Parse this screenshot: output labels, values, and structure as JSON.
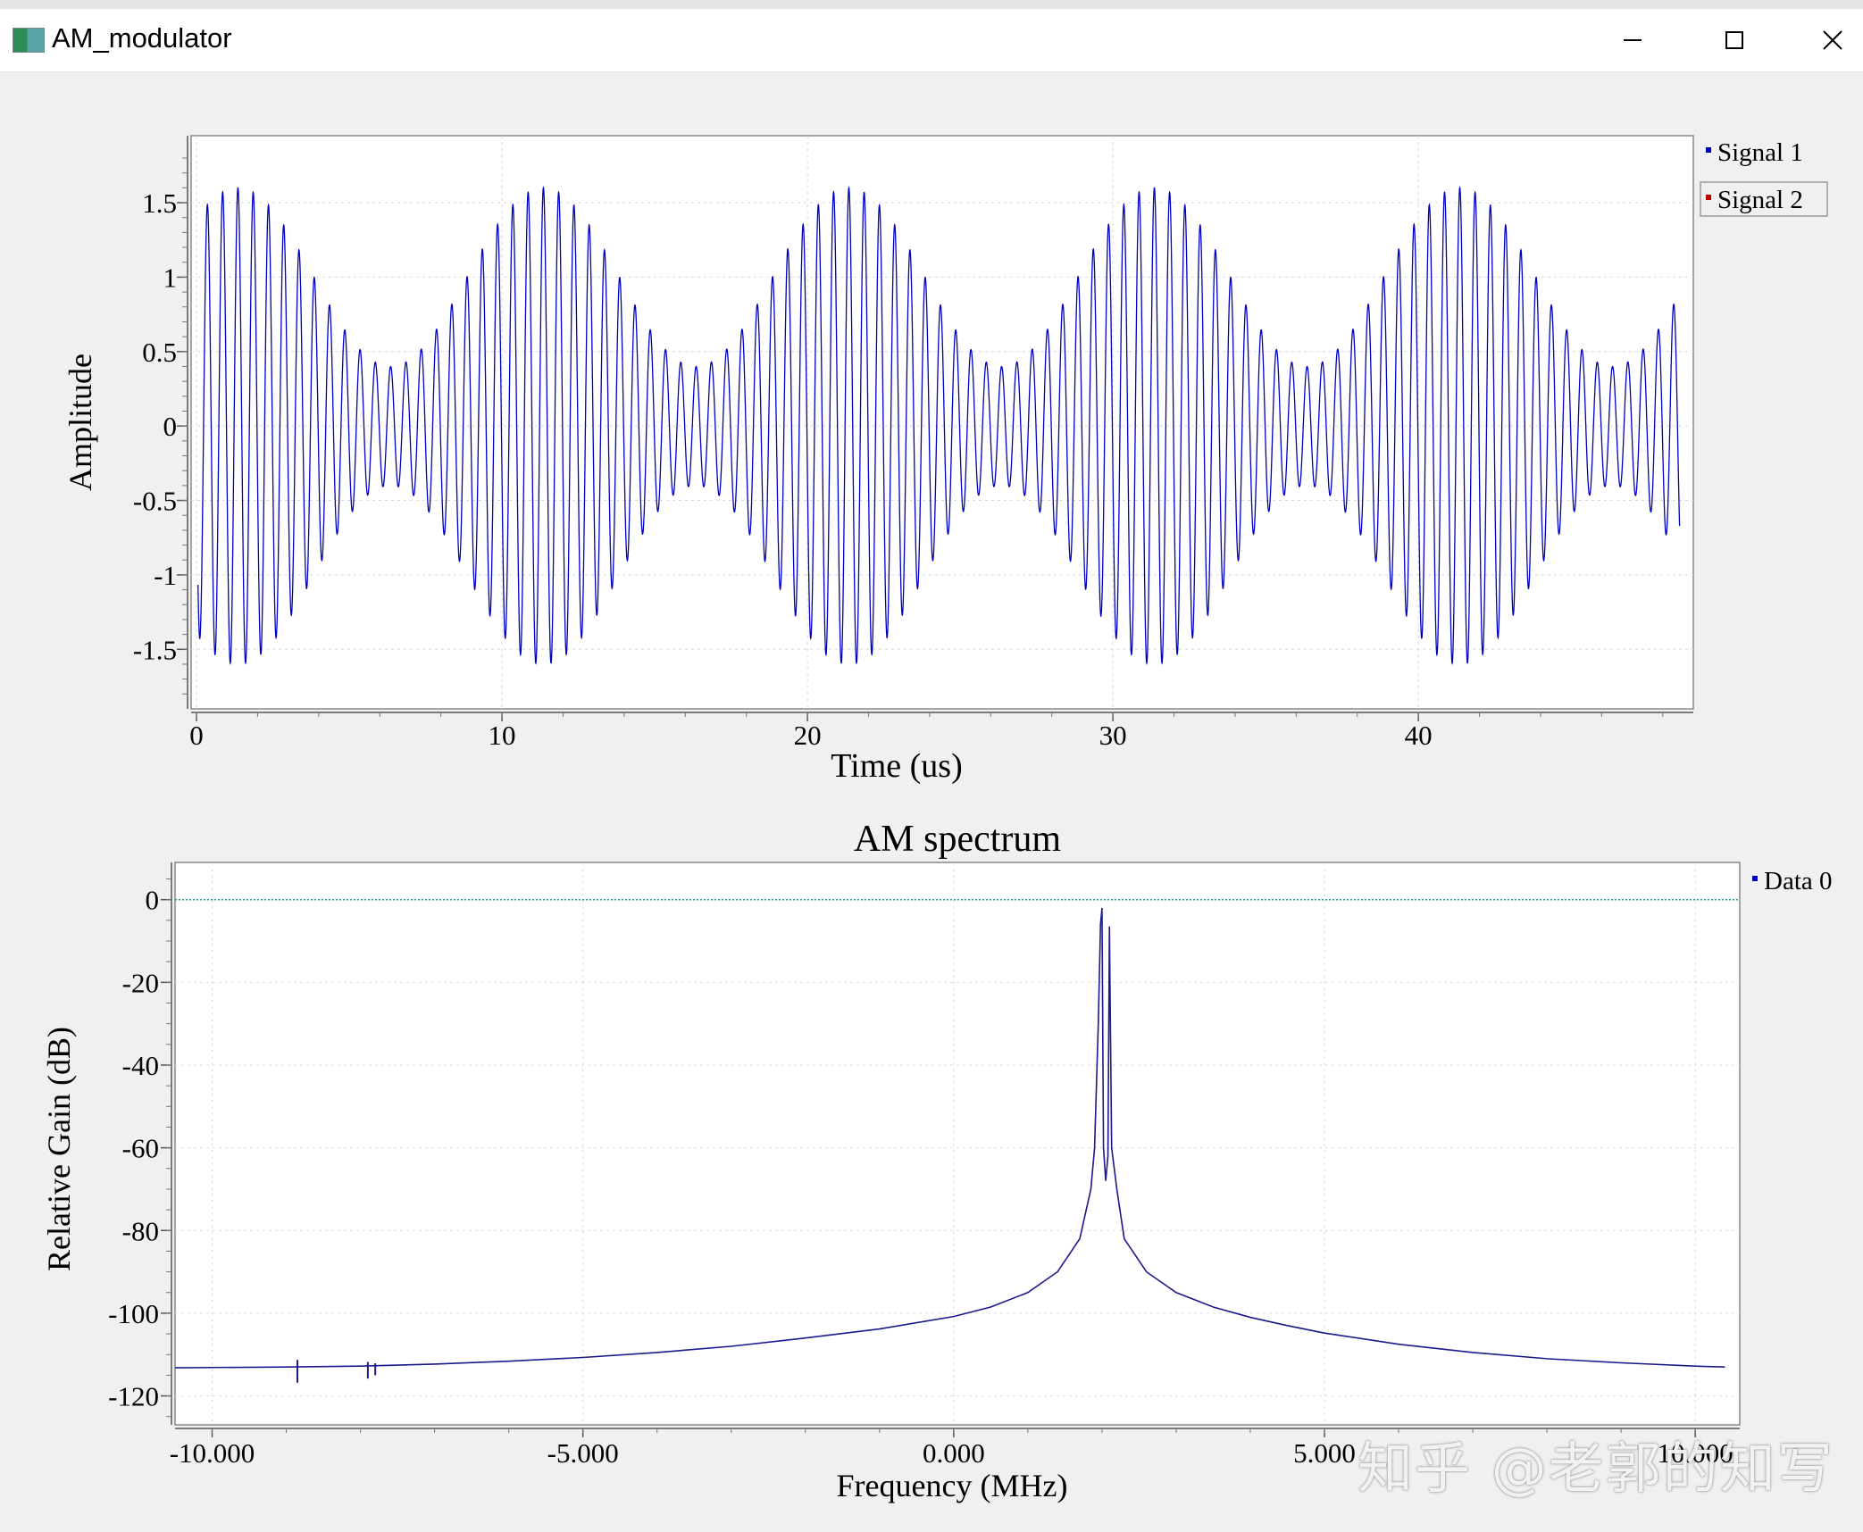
{
  "window": {
    "title": "AM_modulator",
    "controls": {
      "minimize": "minimize",
      "maximize": "maximize",
      "close": "close"
    }
  },
  "watermark": "知乎 @老郭的知写",
  "chart_data": [
    {
      "type": "line",
      "title": "",
      "xlabel": "Time (us)",
      "ylabel": "Amplitude",
      "xlim": [
        0,
        49
      ],
      "ylim": [
        -1.9,
        1.95
      ],
      "xticks": [
        "0",
        "10",
        "20",
        "30",
        "40"
      ],
      "yticks": [
        "1.5",
        "1",
        "0.5",
        "0",
        "-0.5",
        "-1",
        "-1.5"
      ],
      "ytick_values": [
        1.5,
        1,
        0.5,
        0,
        -0.5,
        -1,
        -1.5
      ],
      "grid": true,
      "legend_position": "top-right",
      "series": [
        {
          "name": "Signal 1",
          "color": "#0000c0",
          "formula": "(1 + 0.6*cos(2*pi*0.1*t)) * cos(2*pi*2.0*t)",
          "carrier_mhz": 2.0,
          "message_mhz": 0.1,
          "modulation_index": 0.6,
          "peak": 1.6,
          "trough_envelope": 0.4
        },
        {
          "name": "Signal 2",
          "color": "#c00000",
          "values": []
        }
      ]
    },
    {
      "type": "line",
      "title": "AM spectrum",
      "xlabel": "Frequency (MHz)",
      "ylabel": "Relative Gain (dB)",
      "xlim": [
        -10.5,
        10.6
      ],
      "ylim": [
        -127,
        9
      ],
      "xticks": [
        "-10.000",
        "-5.000",
        "0.000",
        "5.000",
        "10.000"
      ],
      "xtick_values": [
        -10,
        -5,
        0,
        5,
        10
      ],
      "yticks": [
        "0",
        "-20",
        "-40",
        "-60",
        "-80",
        "-100",
        "-120"
      ],
      "ytick_values": [
        0,
        -20,
        -40,
        -60,
        -80,
        -100,
        -120
      ],
      "grid": true,
      "legend_position": "top-right",
      "reference_line_db": 0,
      "series": [
        {
          "name": "Data 0",
          "color": "#1a1a8c",
          "points": [
            [
              -10.5,
              -113.2
            ],
            [
              -9,
              -113.0
            ],
            [
              -8,
              -112.8
            ],
            [
              -7,
              -112.3
            ],
            [
              -6,
              -111.6
            ],
            [
              -5,
              -110.7
            ],
            [
              -4,
              -109.5
            ],
            [
              -3,
              -108.0
            ],
            [
              -2,
              -106.0
            ],
            [
              -1,
              -103.8
            ],
            [
              -0.5,
              -102.3
            ],
            [
              0,
              -100.8
            ],
            [
              0.5,
              -98.5
            ],
            [
              1.0,
              -95.0
            ],
            [
              1.4,
              -90.0
            ],
            [
              1.7,
              -82.0
            ],
            [
              1.85,
              -70.0
            ],
            [
              1.9,
              -60.0
            ],
            [
              1.95,
              -30.0
            ],
            [
              1.98,
              -6.0
            ],
            [
              2.0,
              -2.0
            ],
            [
              2.02,
              -60.0
            ],
            [
              2.05,
              -68.0
            ],
            [
              2.08,
              -62.0
            ],
            [
              2.1,
              -6.5
            ],
            [
              2.13,
              -60.0
            ],
            [
              2.2,
              -70.0
            ],
            [
              2.3,
              -82.0
            ],
            [
              2.6,
              -90.0
            ],
            [
              3,
              -95.0
            ],
            [
              3.5,
              -98.5
            ],
            [
              4,
              -101.0
            ],
            [
              4.5,
              -103.0
            ],
            [
              5,
              -104.8
            ],
            [
              6,
              -107.5
            ],
            [
              7,
              -109.5
            ],
            [
              8,
              -111.0
            ],
            [
              9,
              -112.0
            ],
            [
              10,
              -112.8
            ],
            [
              10.4,
              -113.0
            ]
          ],
          "artifacts": [
            {
              "x": -8.85,
              "low": -116.8,
              "high": -111.3
            },
            {
              "x": -7.9,
              "low": -115.8,
              "high": -111.8
            },
            {
              "x": -7.8,
              "low": -115.0,
              "high": -112.1
            }
          ]
        }
      ]
    }
  ]
}
